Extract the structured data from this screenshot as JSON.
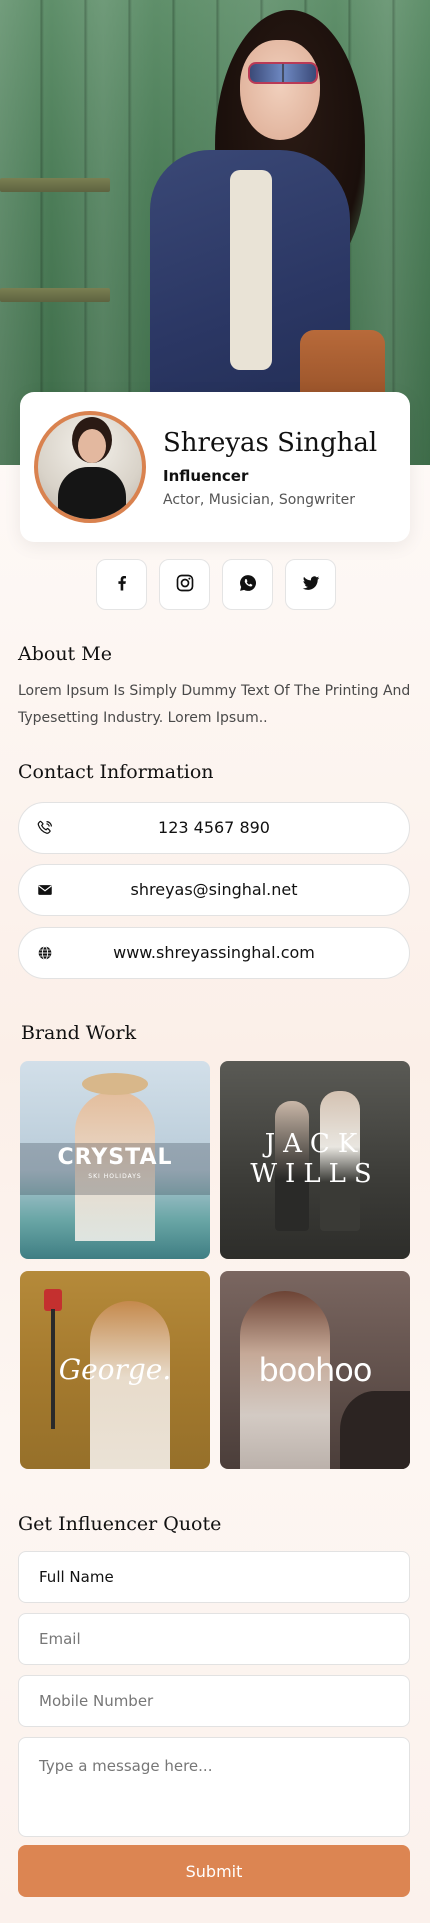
{
  "profile": {
    "name": "Shreyas Singhal",
    "role": "Influencer",
    "tags": "Actor, Musician, Songwriter"
  },
  "social": [
    {
      "name": "facebook",
      "icon": "facebook-icon"
    },
    {
      "name": "instagram",
      "icon": "instagram-icon"
    },
    {
      "name": "whatsapp",
      "icon": "whatsapp-icon"
    },
    {
      "name": "twitter",
      "icon": "twitter-icon"
    }
  ],
  "about": {
    "title": "About Me",
    "text": "Lorem Ipsum Is Simply Dummy Text Of The Printing And Typesetting Industry. Lorem Ipsum.."
  },
  "contact": {
    "title": "Contact Information",
    "phone": "123 4567 890",
    "email": "shreyas@singhal.net",
    "website": "www.shreyassinghal.com"
  },
  "brands": {
    "title": "Brand Work",
    "items": [
      {
        "name": "CRYSTAL",
        "sub": "SKI HOLIDAYS"
      },
      {
        "name": "JACK",
        "name2": "WILLS"
      },
      {
        "name": "George."
      },
      {
        "name": "boohoo"
      }
    ]
  },
  "quote": {
    "title": "Get Influencer Quote",
    "full_name_placeholder": "Full Name",
    "email_placeholder": "Email",
    "mobile_placeholder": "Mobile Number",
    "message_placeholder": "Type a message here...",
    "submit_label": "Submit"
  },
  "colors": {
    "accent": "#dc8552",
    "avatar_ring": "#d9824f"
  }
}
